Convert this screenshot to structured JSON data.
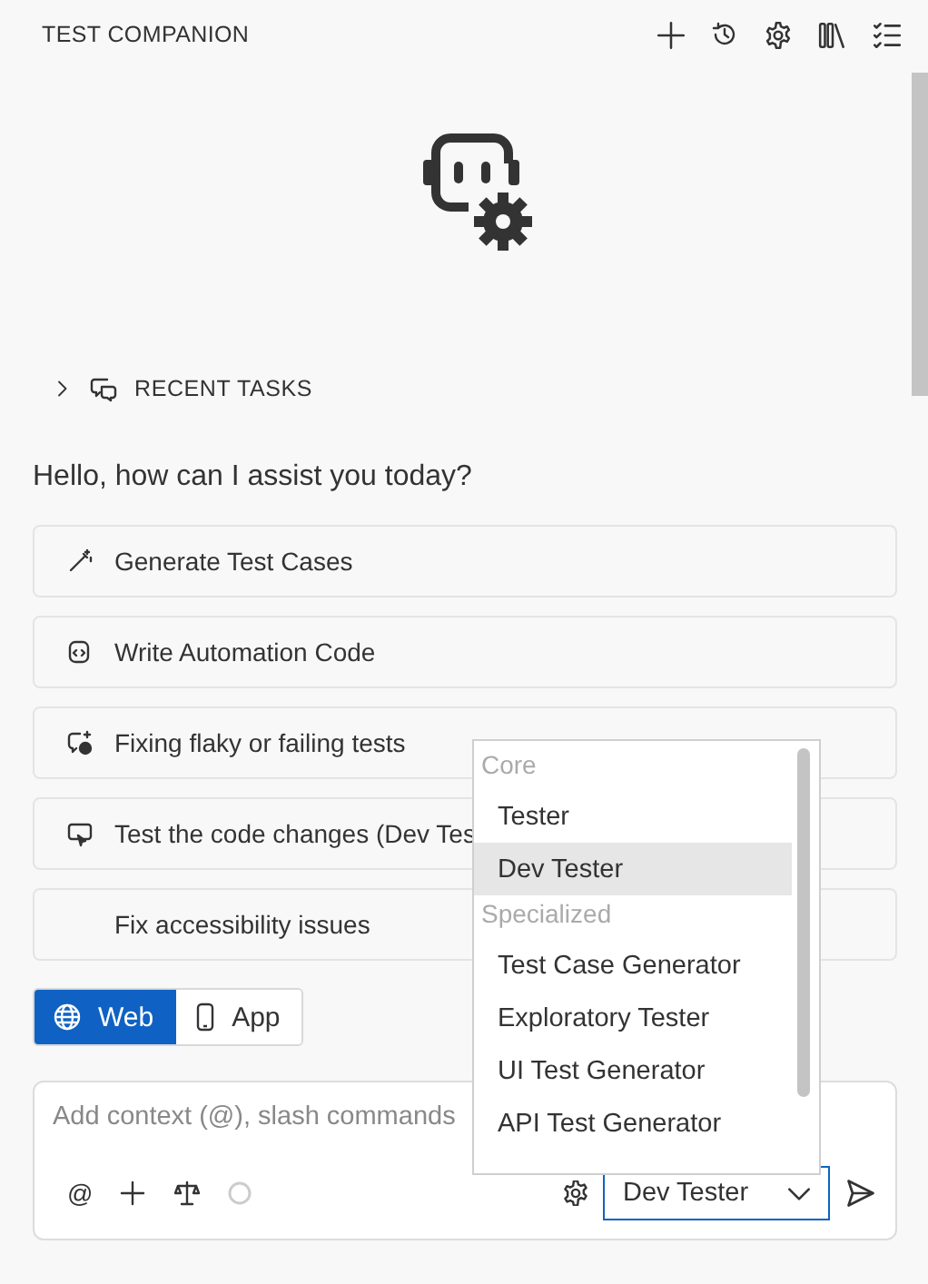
{
  "header": {
    "title": "TEST COMPANION"
  },
  "recent_tasks": {
    "label": "RECENT TASKS",
    "expanded": false
  },
  "greeting": "Hello, how can I assist you today?",
  "suggestions": [
    {
      "kind": "generate",
      "label": "Generate Test Cases"
    },
    {
      "kind": "code",
      "label": "Write Automation Code"
    },
    {
      "kind": "fix",
      "label": "Fixing flaky or failing tests"
    },
    {
      "kind": "changes",
      "label": "Test the code changes (Dev Tes"
    },
    {
      "kind": "none",
      "label": "Fix accessibility issues"
    }
  ],
  "platform_tabs": [
    {
      "kind": "web",
      "label": "Web",
      "selected": true
    },
    {
      "kind": "app",
      "label": "App",
      "selected": false
    }
  ],
  "composer": {
    "placeholder": "Add context (@), slash commands",
    "mention": "@",
    "agent": "Dev Tester"
  },
  "agent_menu": {
    "groups": [
      {
        "label": "Core",
        "items": [
          {
            "label": "Tester",
            "selected": false
          },
          {
            "label": "Dev Tester",
            "selected": true
          }
        ]
      },
      {
        "label": "Specialized",
        "items": [
          {
            "label": "Test Case Generator",
            "selected": false
          },
          {
            "label": "Exploratory Tester",
            "selected": false
          },
          {
            "label": "UI Test Generator",
            "selected": false
          },
          {
            "label": "API Test Generator",
            "selected": false
          }
        ]
      }
    ]
  }
}
